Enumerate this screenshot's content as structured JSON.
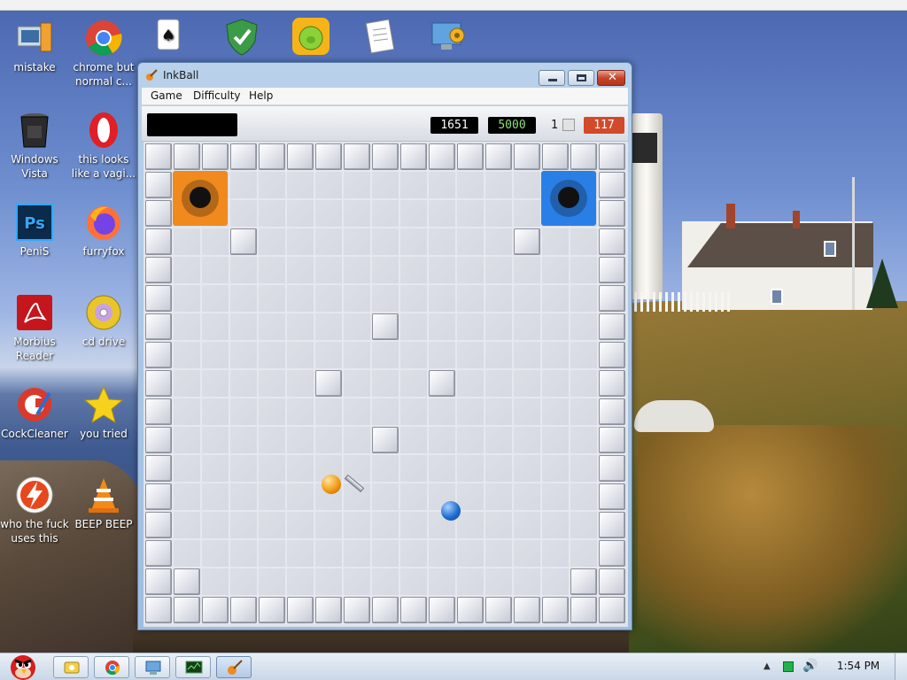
{
  "desktop": {
    "icons": [
      {
        "label": "mistake",
        "icon": "computer-folder-icon"
      },
      {
        "label": "chrome but normal c...",
        "icon": "chrome-icon"
      },
      {
        "label": "Windows Vista",
        "icon": "trash-can-icon"
      },
      {
        "label": "this looks like a vagi...",
        "icon": "opera-icon"
      },
      {
        "label": "PeniS",
        "icon": "photoshop-icon"
      },
      {
        "label": "furryfox",
        "icon": "firefox-icon"
      },
      {
        "label": "Morbius Reader",
        "icon": "acrobat-reader-icon"
      },
      {
        "label": "cd drive",
        "icon": "cd-drive-icon"
      },
      {
        "label": "CockCleaner",
        "icon": "ccleaner-icon"
      },
      {
        "label": "you tried",
        "icon": "gold-star-icon"
      },
      {
        "label": "who the fuck uses this",
        "icon": "flash-player-icon"
      },
      {
        "label": "BEEP BEEP",
        "icon": "vlc-cone-icon"
      }
    ],
    "top_icons": [
      "solitaire-icon",
      "security-shield-icon",
      "bad-piggies-icon",
      "documents-icon",
      "control-panel-icon"
    ]
  },
  "window": {
    "title": "InkBall",
    "menu": [
      "Game",
      "Difficulty",
      "Help"
    ],
    "scores": {
      "score": "1651",
      "target": "5000",
      "level": "1",
      "time": "117"
    }
  },
  "colors": {
    "orange_hole": "#f08a1e",
    "blue_hole": "#2a7fe6",
    "orange_ball": "#f39a14",
    "blue_ball": "#1e6fd1",
    "time_badge": "#d14a2a"
  },
  "taskbar": {
    "apps": [
      "explorer-icon",
      "chrome-icon",
      "network-icon",
      "task-manager-icon",
      "inkball-icon"
    ],
    "clock": "1:54 PM"
  }
}
